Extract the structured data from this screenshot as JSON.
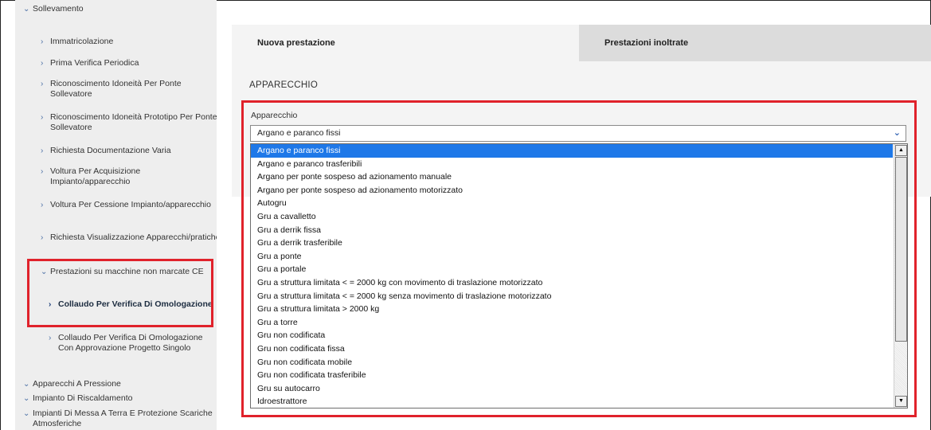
{
  "sidebar": {
    "items": [
      {
        "label": "Sollevamento"
      },
      {
        "label": "Immatricolazione"
      },
      {
        "label": "Prima Verifica Periodica"
      },
      {
        "label": "Riconoscimento Idoneità Per Ponte Sollevatore"
      },
      {
        "label": "Riconoscimento Idoneità Prototipo Per Ponte Sollevatore"
      },
      {
        "label": "Richiesta Documentazione Varia"
      },
      {
        "label": "Voltura Per Acquisizione Impianto/apparecchio"
      },
      {
        "label": "Voltura Per Cessione Impianto/apparecchio"
      },
      {
        "label": "Richiesta Visualizzazione Apparecchi/pratiche"
      },
      {
        "label": "Prestazioni su macchine non marcate CE"
      },
      {
        "label": "Collaudo Per Verifica Di Omologazione"
      },
      {
        "label": "Collaudo Per Verifica Di Omologazione Con Approvazione Progetto Singolo"
      },
      {
        "label": "Apparecchi A Pressione"
      },
      {
        "label": "Impianto Di Riscaldamento"
      },
      {
        "label": "Impianti Di Messa A Terra E Protezione Scariche Atmosferiche"
      }
    ]
  },
  "tabs": {
    "new": "Nuova prestazione",
    "submitted": "Prestazioni inoltrate"
  },
  "section": {
    "title": "APPARECCHIO"
  },
  "field": {
    "label": "Apparecchio",
    "value": "Argano e paranco fissi"
  },
  "options": [
    "Argano e paranco fissi",
    "Argano e paranco trasferibili",
    "Argano per ponte sospeso ad azionamento manuale",
    "Argano per ponte sospeso ad azionamento motorizzato",
    "Autogru",
    "Gru a cavalletto",
    "Gru a derrik fissa",
    "Gru a derrik trasferibile",
    "Gru a ponte",
    "Gru a portale",
    "Gru a struttura limitata < = 2000 kg con movimento di traslazione motorizzato",
    "Gru a struttura limitata < = 2000 kg senza movimento di traslazione motorizzato",
    "Gru a struttura limitata > 2000 kg",
    "Gru a torre",
    "Gru non codificata",
    "Gru non codificata fissa",
    "Gru non codificata mobile",
    "Gru non codificata trasferibile",
    "Gru su autocarro",
    "Idroestrattore"
  ],
  "icons": {
    "chevron_down": "⌄",
    "chevron_right": "›",
    "scroll_up": "▲",
    "scroll_down": "▼"
  },
  "colors": {
    "highlight_box": "#e0222b",
    "selected_option": "#1e78e8",
    "sidebar_bg": "#eeeeee"
  }
}
